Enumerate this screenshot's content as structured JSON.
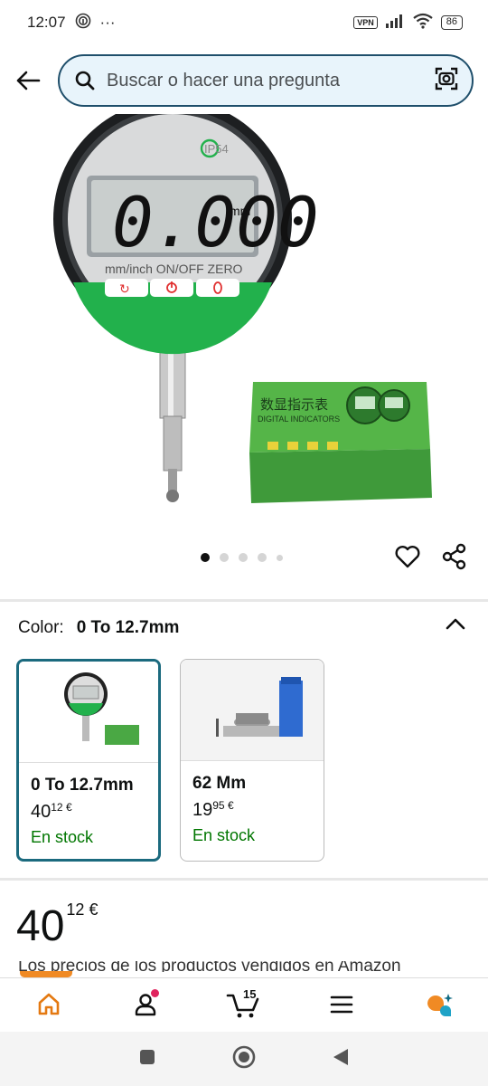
{
  "status": {
    "time": "12:07",
    "vpn": "VPN",
    "battery": "86"
  },
  "search": {
    "placeholder": "Buscar o hacer una pregunta"
  },
  "product_image": {
    "display_reading": "0.000",
    "display_unit": "mm",
    "ip_label": "IP54",
    "button_labels": "mm/inch ON/OFF ZERO",
    "box_title_cn": "数显指示表",
    "box_title_en": "DIGITAL INDICATORS"
  },
  "carousel": {
    "total": 5,
    "active": 0
  },
  "color": {
    "label": "Color:",
    "selected": "0 To 12.7mm",
    "variants": [
      {
        "name": "0 To 12.7mm",
        "price_whole": "40",
        "price_fraction": "12",
        "currency": "€",
        "stock": "En stock",
        "selected": true
      },
      {
        "name": "62 Mm",
        "price_whole": "19",
        "price_fraction": "95",
        "currency": "€",
        "stock": "En stock",
        "selected": false
      }
    ]
  },
  "price": {
    "whole": "40",
    "fraction": "12",
    "currency": "€"
  },
  "note_cut": "Los precios de los productos vendidos en Amazon",
  "nav": {
    "cart_count": "15"
  },
  "colors": {
    "accent": "#1b6a7e",
    "stock_green": "#007600",
    "home_orange": "#e47911",
    "search_border": "#1f4f6b"
  }
}
